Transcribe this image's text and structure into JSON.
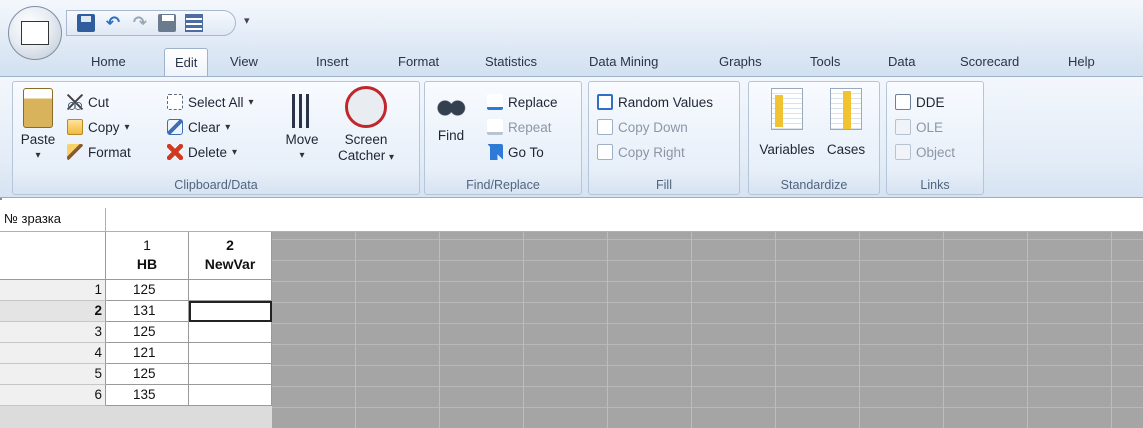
{
  "quick_access": {
    "app_icon": "statistica-icon",
    "buttons": [
      "save-icon",
      "undo-icon",
      "redo-icon",
      "print-icon",
      "grid-icon"
    ],
    "customize": "▾"
  },
  "tabs": [
    "Home",
    "Edit",
    "View",
    "Insert",
    "Format",
    "Statistics",
    "Data Mining",
    "Graphs",
    "Tools",
    "Data",
    "Scorecard",
    "Help"
  ],
  "active_tab": "Edit",
  "ribbon": {
    "clipboard": {
      "label": "Clipboard/Data",
      "paste": "Paste",
      "cut": "Cut",
      "copy": "Copy",
      "format": "Format",
      "select_all": "Select All",
      "clear": "Clear",
      "delete": "Delete",
      "move": "Move",
      "screen_catcher_1": "Screen",
      "screen_catcher_2": "Catcher"
    },
    "find_replace": {
      "label": "Find/Replace",
      "find": "Find",
      "replace": "Replace",
      "repeat": "Repeat",
      "go_to": "Go To"
    },
    "fill": {
      "label": "Fill",
      "random_values": "Random Values",
      "copy_down": "Copy Down",
      "copy_right": "Copy Right"
    },
    "standardize": {
      "label": "Standardize",
      "variables": "Variables",
      "cases": "Cases"
    },
    "links": {
      "label": "Links",
      "dde": "DDE",
      "ole": "OLE",
      "object": "Object"
    }
  },
  "sheet": {
    "case_name_header": "№ зразка",
    "columns": [
      {
        "number": "1",
        "name": "HB"
      },
      {
        "number": "2",
        "name": "NewVar"
      }
    ],
    "rows": [
      {
        "n": "1",
        "hb": "125",
        "newvar": ""
      },
      {
        "n": "2",
        "hb": "131",
        "newvar": ""
      },
      {
        "n": "3",
        "hb": "125",
        "newvar": ""
      },
      {
        "n": "4",
        "hb": "121",
        "newvar": ""
      },
      {
        "n": "5",
        "hb": "125",
        "newvar": ""
      },
      {
        "n": "6",
        "hb": "135",
        "newvar": ""
      }
    ],
    "active_row": "2"
  }
}
